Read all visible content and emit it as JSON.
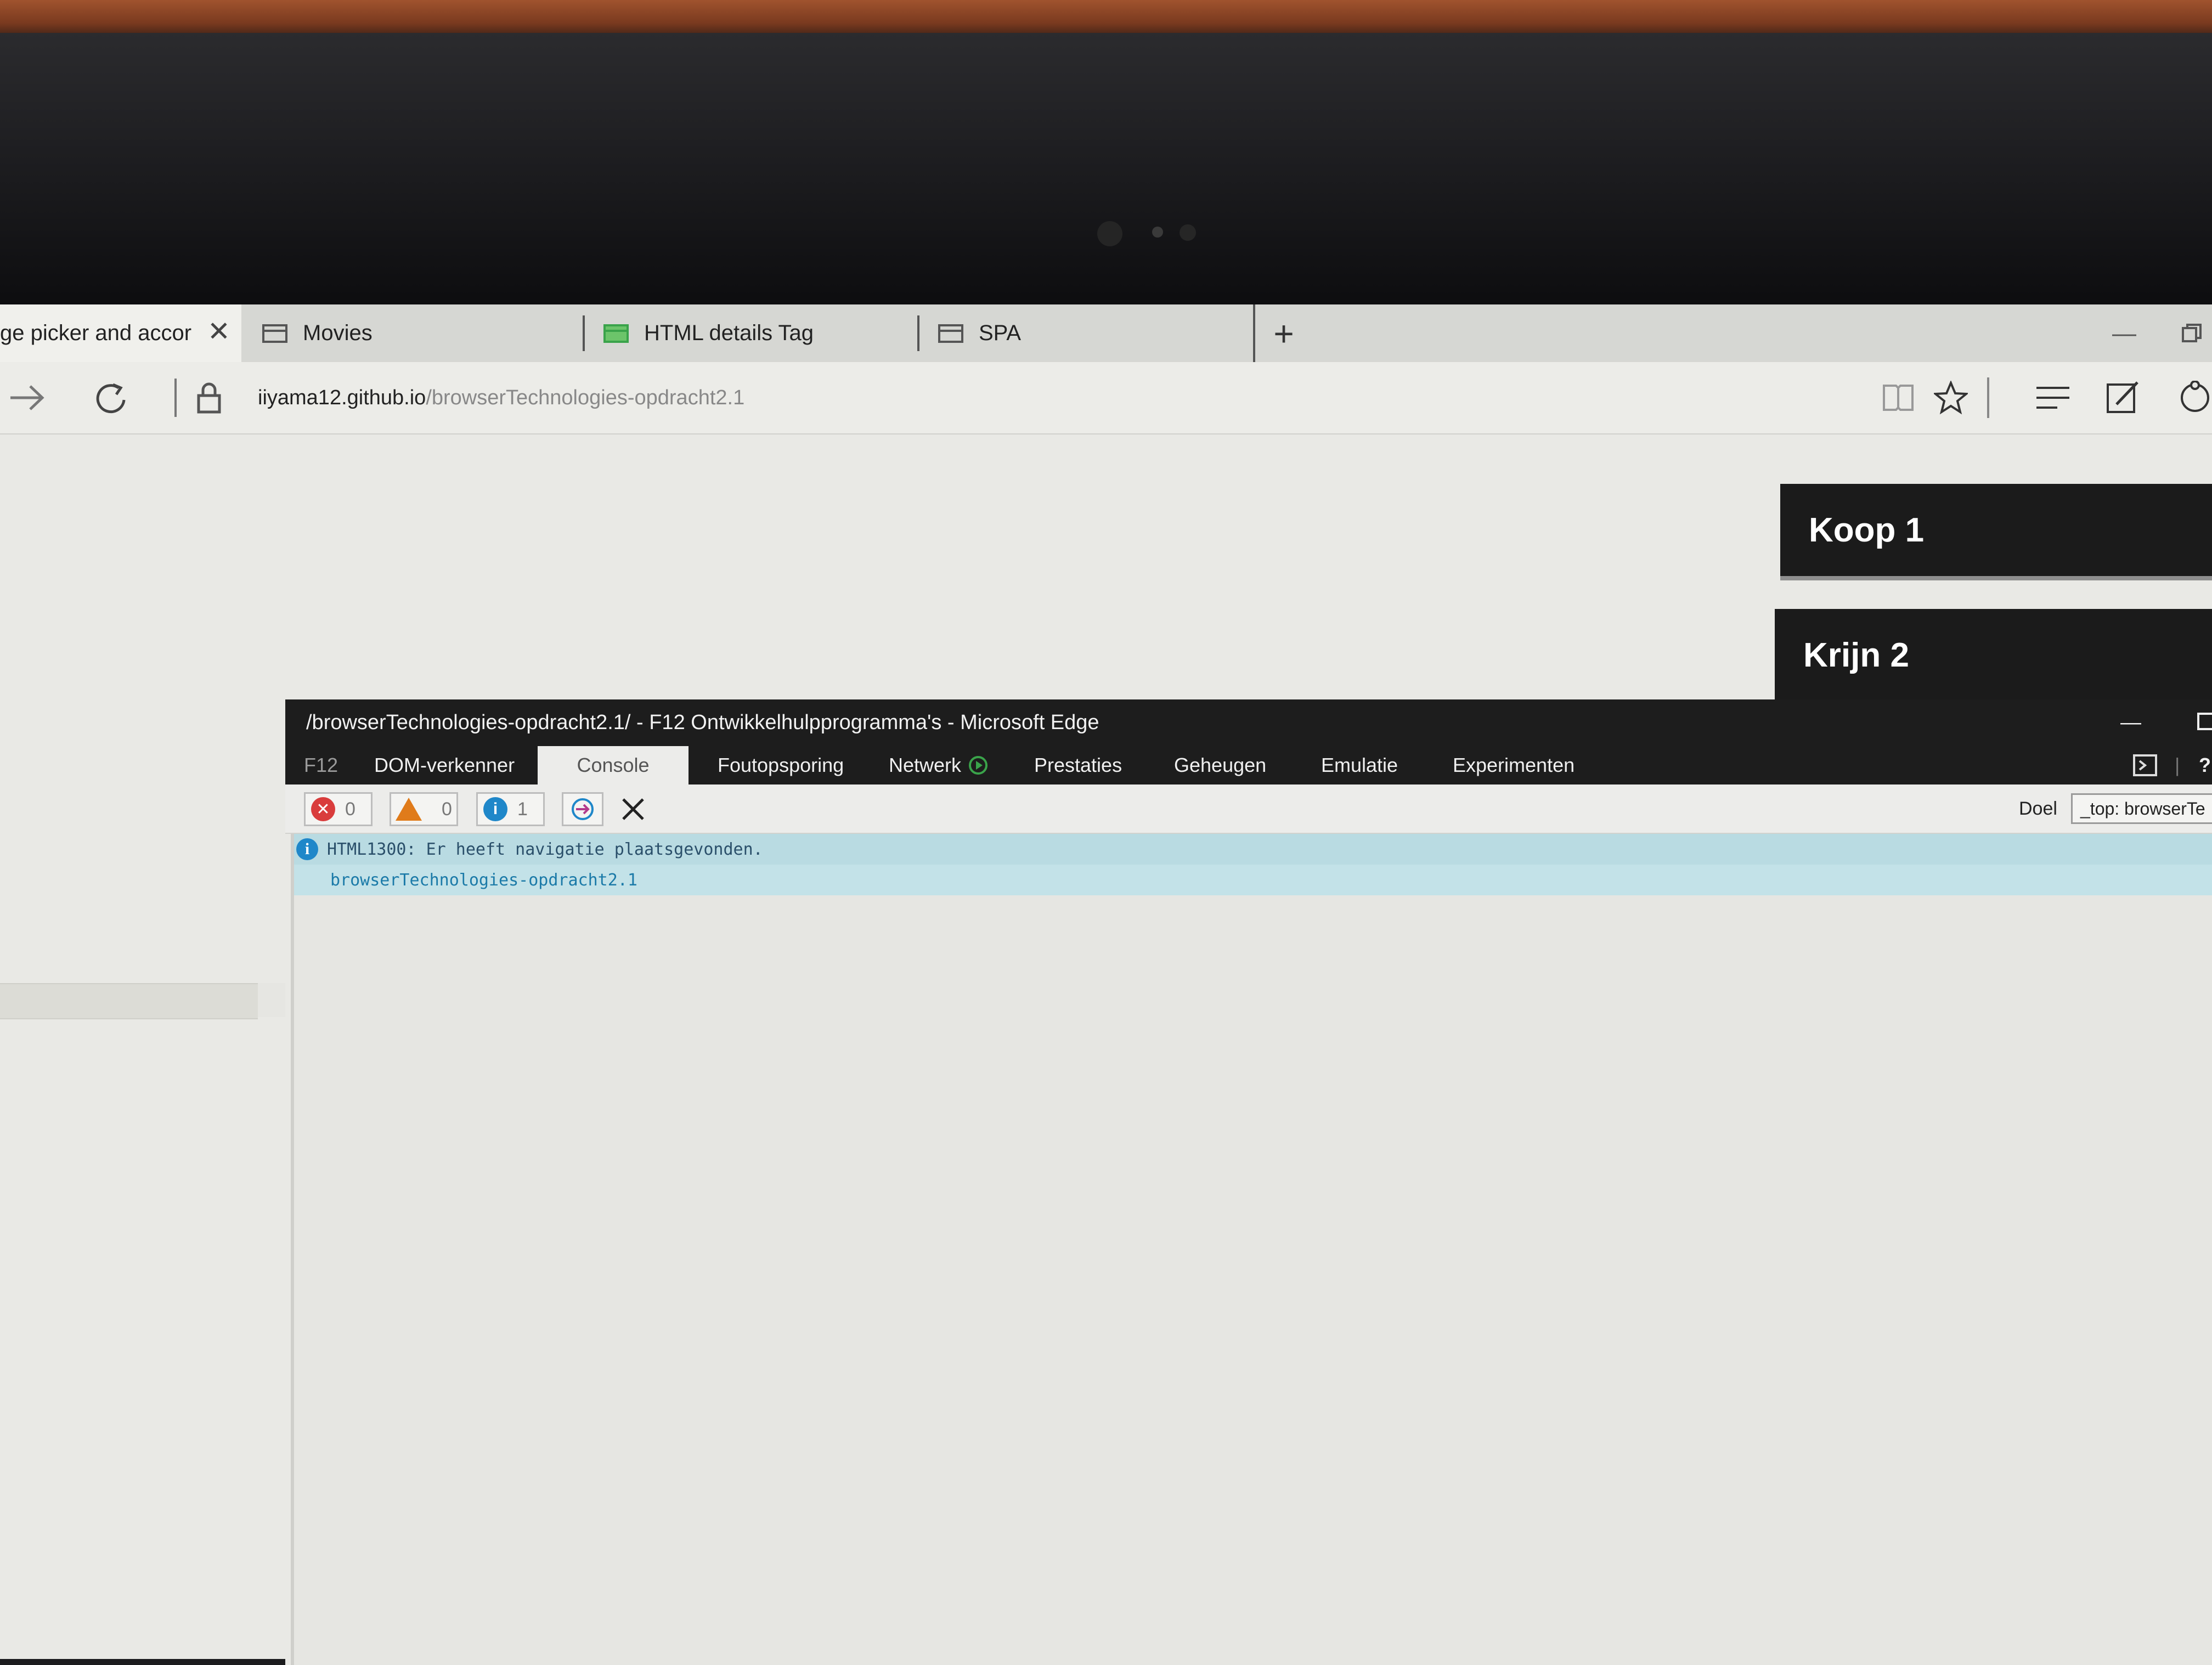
{
  "tabs": [
    {
      "label": "ge picker and accor"
    },
    {
      "label": "Movies"
    },
    {
      "label": "HTML details Tag"
    },
    {
      "label": "SPA"
    }
  ],
  "address": {
    "host": "iiyama12.github.io",
    "path": "/browserTechnologies-opdracht2.1"
  },
  "page": {
    "buttons": [
      "Koop 1",
      "Krijn 2"
    ]
  },
  "devtools": {
    "title": "/browserTechnologies-opdracht2.1/ - F12 Ontwikkelhulpprogramma's - Microsoft Edge",
    "tabs": [
      "F12",
      "DOM-verkenner",
      "Console",
      "Foutopsporing",
      "Netwerk",
      "Prestaties",
      "Geheugen",
      "Emulatie",
      "Experimenten"
    ],
    "active_tab": "Console",
    "counts": {
      "errors": "0",
      "warnings": "0",
      "info": "1"
    },
    "target_label": "Doel",
    "target_value": "_top: browserTe",
    "log": [
      {
        "message": "HTML1300: Er heeft navigatie plaatsgevonden."
      },
      {
        "message": "browserTechnologies-opdracht2.1"
      }
    ]
  },
  "colors": {
    "devtools_bar": "#1d1d1d",
    "log_highlight": "#b9dbe2",
    "info_blue": "#1f87c9",
    "error_red": "#d93c3c",
    "warning_orange": "#e07b1a"
  },
  "icons": [
    "close-icon",
    "tab-page-icon",
    "forward-icon",
    "refresh-icon",
    "lock-icon",
    "reading-view-icon",
    "favorite-star-icon",
    "hub-icon",
    "web-note-icon",
    "share-icon",
    "play-icon",
    "error-icon",
    "warning-icon",
    "info-icon",
    "clear-icon"
  ]
}
